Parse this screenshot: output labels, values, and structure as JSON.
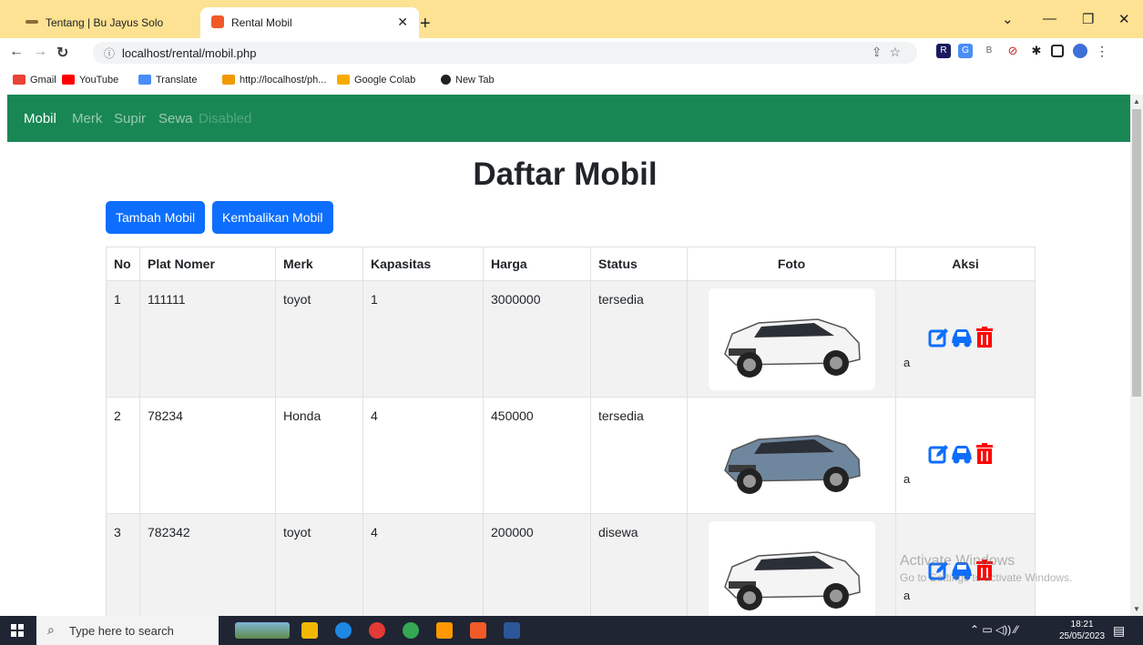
{
  "browser": {
    "tabs": [
      {
        "title": "Tentang | Bu Jayus Solo"
      },
      {
        "title": "Rental Mobil"
      }
    ],
    "url": "localhost/rental/mobil.php",
    "bookmarks": [
      "Gmail",
      "YouTube",
      "Translate",
      "http://localhost/ph...",
      "Google Colab",
      "New Tab"
    ]
  },
  "navbar": {
    "items": [
      "Mobil",
      "Merk",
      "Supir",
      "Sewa",
      "Disabled"
    ]
  },
  "page": {
    "title": "Daftar Mobil",
    "buttons": {
      "add": "Tambah Mobil",
      "return": "Kembalikan Mobil"
    }
  },
  "table": {
    "headers": [
      "No",
      "Plat Nomer",
      "Merk",
      "Kapasitas",
      "Harga",
      "Status",
      "Foto",
      "Aksi"
    ],
    "rows": [
      {
        "no": "1",
        "plat": "111111",
        "merk": "toyot",
        "kapasitas": "1",
        "harga": "3000000",
        "status": "tersedia",
        "aksi_text": "a",
        "car_color": "#f4f4f4"
      },
      {
        "no": "2",
        "plat": "78234",
        "merk": "Honda",
        "kapasitas": "4",
        "harga": "450000",
        "status": "tersedia",
        "aksi_text": "a",
        "car_color": "#6f879e"
      },
      {
        "no": "3",
        "plat": "782342",
        "merk": "toyot",
        "kapasitas": "4",
        "harga": "200000",
        "status": "disewa",
        "aksi_text": "a",
        "car_color": "#f4f4f4"
      }
    ]
  },
  "watermark": {
    "line1": "Activate Windows",
    "line2": "Go to Settings to activate Windows."
  },
  "taskbar": {
    "search_placeholder": "Type here to search",
    "time": "18:21",
    "date": "25/05/2023"
  },
  "colors": {
    "navbar": "#198754",
    "primary": "#0d6efd",
    "danger": "#dc3545"
  }
}
